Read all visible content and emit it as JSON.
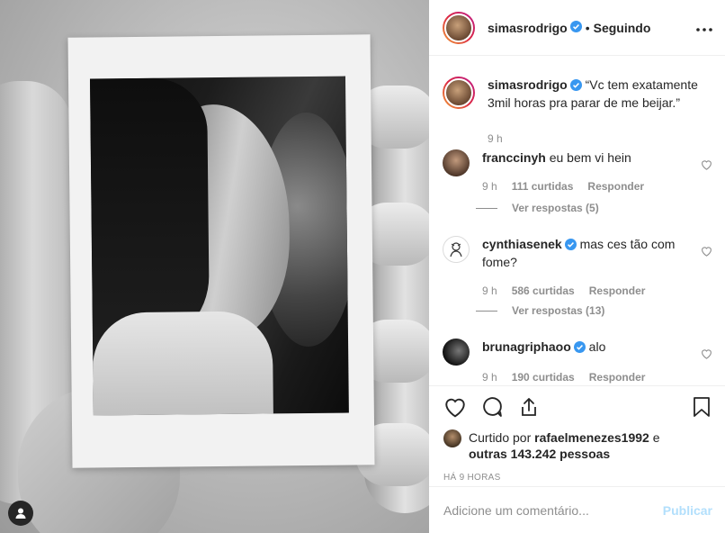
{
  "post": {
    "photo_alt_icon": "user-tag-icon"
  },
  "header": {
    "username": "simasrodrigo",
    "separator": "•",
    "follow_status": "Seguindo",
    "more_icon": "more-options-icon"
  },
  "caption": {
    "username": "simasrodrigo",
    "text": "“Vc tem exatamente 3mil horas pra parar de me beijar.”",
    "time": "9 h"
  },
  "comments": [
    {
      "username": "franccinyh",
      "text": "eu bem vi hein",
      "time": "9 h",
      "likes": "111 curtidas",
      "reply": "Responder",
      "view_replies": "Ver respostas (5)",
      "verified": false
    },
    {
      "username": "cynthiasenek",
      "text": "mas ces tão com fome?",
      "time": "9 h",
      "likes": "586 curtidas",
      "reply": "Responder",
      "view_replies": "Ver respostas (13)",
      "verified": true
    },
    {
      "username": "brunagriphaoo",
      "text": "alo",
      "time": "9 h",
      "likes": "190 curtidas",
      "reply": "Responder",
      "verified": true
    }
  ],
  "likes": {
    "prefix": "Curtido por",
    "user": "rafaelmenezes1992",
    "conjunction": "e",
    "others": "outras 143.242 pessoas"
  },
  "timestamp": "HÁ 9 HORAS",
  "add_comment": {
    "placeholder": "Adicione um comentário...",
    "publish": "Publicar"
  },
  "colors": {
    "verified": "#3897f0",
    "publish_disabled": "#b2dffc",
    "muted": "#8e8e8e"
  }
}
